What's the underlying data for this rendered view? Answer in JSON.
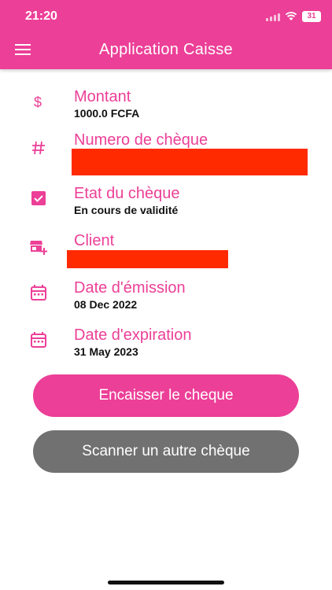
{
  "status_bar": {
    "time": "21:20",
    "battery": "31"
  },
  "app_bar": {
    "title": "Application Caisse",
    "menu_icon": "menu-icon"
  },
  "fields": {
    "montant": {
      "icon": "dollar-icon",
      "label": "Montant",
      "value": "1000.0 FCFA"
    },
    "numero": {
      "icon": "hash-icon",
      "label": "Numero de chèque"
    },
    "etat": {
      "icon": "checkbox-icon",
      "label": "Etat du chèque",
      "value": "En cours de validité"
    },
    "client": {
      "icon": "store-add-icon",
      "label": "Client"
    },
    "date_emission": {
      "icon": "calendar-icon",
      "label": "Date d'émission",
      "value": "08 Dec 2022"
    },
    "date_expiration": {
      "icon": "calendar-icon",
      "label": "Date d'expiration",
      "value": "31 May 2023"
    }
  },
  "buttons": {
    "encaisser": "Encaisser le cheque",
    "scanner": "Scanner un autre chèque"
  },
  "colors": {
    "primary": "#ec3f97",
    "secondary_button": "#717171",
    "redaction": "#ff2a00"
  }
}
